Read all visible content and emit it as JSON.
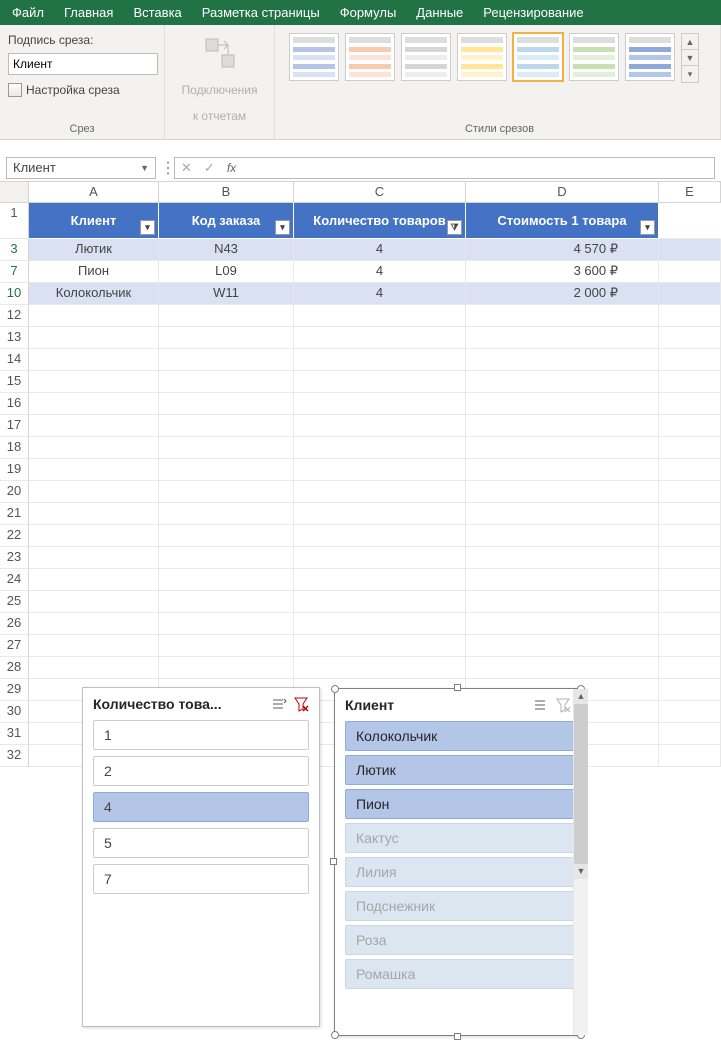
{
  "ribbon": {
    "tabs": [
      "Файл",
      "Главная",
      "Вставка",
      "Разметка страницы",
      "Формулы",
      "Данные",
      "Рецензирование"
    ],
    "slice_group": {
      "caption_label": "Подпись среза:",
      "caption_value": "Клиент",
      "settings_label": "Настройка среза",
      "group_label": "Срез"
    },
    "connections": {
      "label1": "Подключения",
      "label2": "к отчетам"
    },
    "styles_group_label": "Стили срезов"
  },
  "formula_bar": {
    "name_box": "Клиент",
    "fx": "fx"
  },
  "columns": [
    "A",
    "B",
    "C",
    "D",
    "E"
  ],
  "table": {
    "headers": [
      "Клиент",
      "Код заказа",
      "Количество товаров",
      "Стоимость 1 товара"
    ],
    "rows": [
      {
        "n": "3",
        "cells": [
          "Лютик",
          "N43",
          "4",
          "4 570 ₽"
        ],
        "band": true
      },
      {
        "n": "7",
        "cells": [
          "Пион",
          "L09",
          "4",
          "3 600 ₽"
        ],
        "band": false
      },
      {
        "n": "10",
        "cells": [
          "Колокольчик",
          "W11",
          "4",
          "2 000 ₽"
        ],
        "band": true
      }
    ]
  },
  "empty_rows": [
    "12",
    "13",
    "14",
    "15",
    "16",
    "17",
    "18",
    "19",
    "20",
    "21",
    "22",
    "23",
    "24",
    "25",
    "26",
    "27",
    "28",
    "29",
    "30",
    "31",
    "32"
  ],
  "header_row_num": "1",
  "slicers": {
    "qty": {
      "title": "Количество това...",
      "items": [
        {
          "label": "1",
          "selected": false
        },
        {
          "label": "2",
          "selected": false
        },
        {
          "label": "4",
          "selected": true
        },
        {
          "label": "5",
          "selected": false
        },
        {
          "label": "7",
          "selected": false
        }
      ]
    },
    "client": {
      "title": "Клиент",
      "items": [
        {
          "label": "Колокольчик",
          "state": "sel"
        },
        {
          "label": "Лютик",
          "state": "sel"
        },
        {
          "label": "Пион",
          "state": "sel"
        },
        {
          "label": "Кактус",
          "state": "dim"
        },
        {
          "label": "Лилия",
          "state": "dim"
        },
        {
          "label": "Подснежник",
          "state": "dim"
        },
        {
          "label": "Роза",
          "state": "dim"
        },
        {
          "label": "Ромашка",
          "state": "dim"
        }
      ]
    }
  }
}
